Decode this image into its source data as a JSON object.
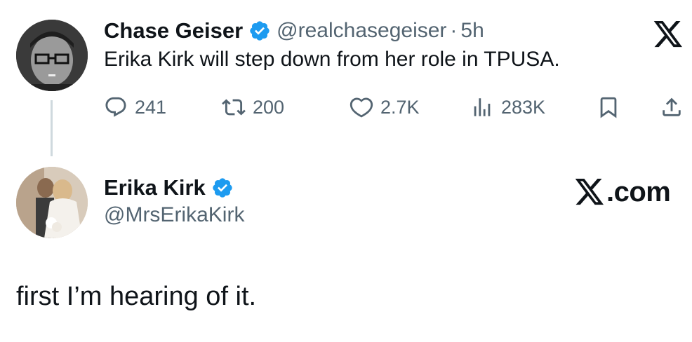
{
  "colors": {
    "verified": "#1d9bf0",
    "secondary_text": "#536471",
    "primary_text": "#0f1419",
    "thread_line": "#cfd9de"
  },
  "quoted_tweet": {
    "author": {
      "display_name": "Chase Geiser",
      "handle": "@realchasegeiser",
      "verified": true,
      "avatar_icon": "avatar-photo"
    },
    "separator": "·",
    "time": "5h",
    "text": "Erika Kirk will step down from her role in TPUSA.",
    "brand_icon": "x-logo-icon",
    "actions": {
      "replies": "241",
      "retweets": "200",
      "likes": "2.7K",
      "views": "283K"
    }
  },
  "reply_tweet": {
    "author": {
      "display_name": "Erika Kirk",
      "handle": "@MrsErikaKirk",
      "verified": true,
      "avatar_icon": "avatar-photo"
    },
    "brand_label": "X.com",
    "text": "first I’m hearing of it."
  }
}
